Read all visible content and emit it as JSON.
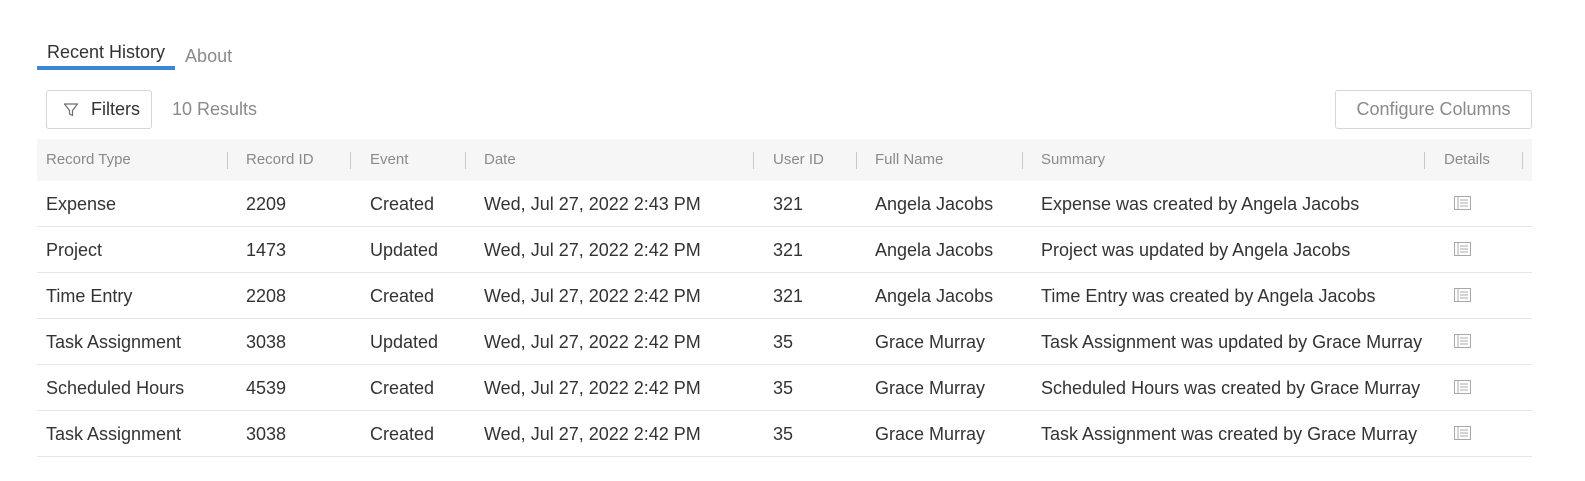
{
  "tabs": [
    {
      "label": "Recent History",
      "active": true
    },
    {
      "label": "About",
      "active": false
    }
  ],
  "toolbar": {
    "filters_label": "Filters",
    "filters_icon": "filter-icon",
    "results_text": "10 Results",
    "configure_label": "Configure Columns"
  },
  "table": {
    "columns": [
      "Record Type",
      "Record ID",
      "Event",
      "Date",
      "User ID",
      "Full Name",
      "Summary",
      "Details"
    ],
    "details_icon": "document-icon",
    "rows": [
      {
        "type": "Expense",
        "id": "2209",
        "event": "Created",
        "date": "Wed, Jul 27, 2022 2:43 PM",
        "user_id": "321",
        "name": "Angela Jacobs",
        "summary": "Expense was created by Angela Jacobs"
      },
      {
        "type": "Project",
        "id": "1473",
        "event": "Updated",
        "date": "Wed, Jul 27, 2022 2:42 PM",
        "user_id": "321",
        "name": "Angela Jacobs",
        "summary": "Project was updated by Angela Jacobs"
      },
      {
        "type": "Time Entry",
        "id": "2208",
        "event": "Created",
        "date": "Wed, Jul 27, 2022 2:42 PM",
        "user_id": "321",
        "name": "Angela Jacobs",
        "summary": "Time Entry was created by Angela Jacobs"
      },
      {
        "type": "Task Assignment",
        "id": "3038",
        "event": "Updated",
        "date": "Wed, Jul 27, 2022 2:42 PM",
        "user_id": "35",
        "name": "Grace Murray",
        "summary": "Task Assignment was updated by Grace Murray"
      },
      {
        "type": "Scheduled Hours",
        "id": "4539",
        "event": "Created",
        "date": "Wed, Jul 27, 2022 2:42 PM",
        "user_id": "35",
        "name": "Grace Murray",
        "summary": "Scheduled Hours was created by Grace Murray"
      },
      {
        "type": "Task Assignment",
        "id": "3038",
        "event": "Created",
        "date": "Wed, Jul 27, 2022 2:42 PM",
        "user_id": "35",
        "name": "Grace Murray",
        "summary": "Task Assignment was created by Grace Murray"
      }
    ]
  },
  "colors": {
    "accent": "#3b86d6",
    "header_bg": "#f6f6f6",
    "muted_text": "#8a8a8a",
    "body_text": "#333333"
  }
}
